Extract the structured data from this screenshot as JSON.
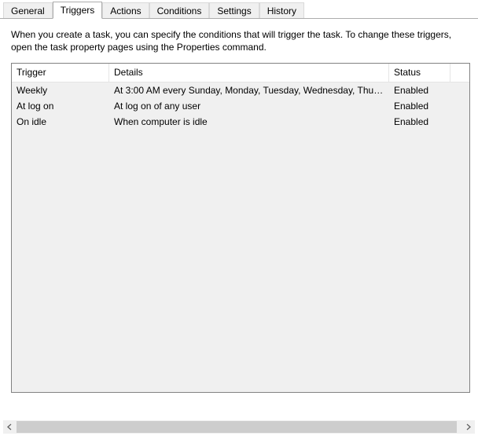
{
  "tabs": {
    "items": [
      {
        "label": "General",
        "active": false
      },
      {
        "label": "Triggers",
        "active": true
      },
      {
        "label": "Actions",
        "active": false
      },
      {
        "label": "Conditions",
        "active": false
      },
      {
        "label": "Settings",
        "active": false
      },
      {
        "label": "History",
        "active": false
      }
    ]
  },
  "description": "When you create a task, you can specify the conditions that will trigger the task.  To change these triggers, open the task property pages using the Properties command.",
  "columns": {
    "trigger": "Trigger",
    "details": "Details",
    "status": "Status"
  },
  "rows": [
    {
      "trigger": "Weekly",
      "details": "At 3:00 AM every Sunday, Monday, Tuesday, Wednesday, Thurs...",
      "status": "Enabled"
    },
    {
      "trigger": "At log on",
      "details": "At log on of any user",
      "status": "Enabled"
    },
    {
      "trigger": "On idle",
      "details": "When computer is idle",
      "status": "Enabled"
    }
  ]
}
